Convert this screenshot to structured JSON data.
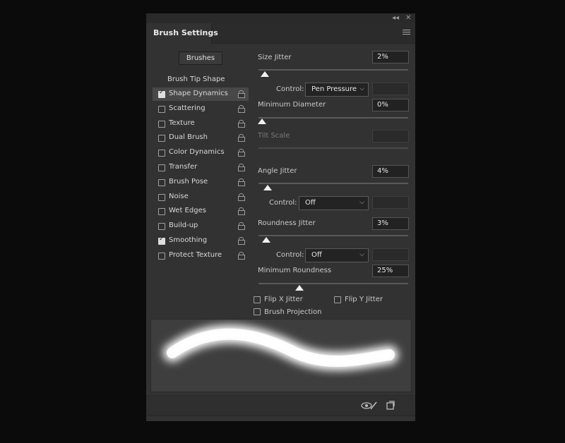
{
  "panel": {
    "title": "Brush Settings"
  },
  "left": {
    "brushes_button": "Brushes",
    "tip_shape_label": "Brush Tip Shape",
    "items": [
      {
        "label": "Shape Dynamics",
        "checked": true,
        "selected": true
      },
      {
        "label": "Scattering",
        "checked": false
      },
      {
        "label": "Texture",
        "checked": false
      },
      {
        "label": "Dual Brush",
        "checked": false
      },
      {
        "label": "Color Dynamics",
        "checked": false
      },
      {
        "label": "Transfer",
        "checked": false
      },
      {
        "label": "Brush Pose",
        "checked": false
      },
      {
        "label": "Noise",
        "checked": false
      },
      {
        "label": "Wet Edges",
        "checked": false
      },
      {
        "label": "Build-up",
        "checked": false
      },
      {
        "label": "Smoothing",
        "checked": true
      },
      {
        "label": "Protect Texture",
        "checked": false
      }
    ]
  },
  "settings": {
    "size_jitter": {
      "label": "Size Jitter",
      "value": "2%",
      "slider": 0.02
    },
    "size_control": {
      "label": "Control:",
      "value": "Pen Pressure"
    },
    "min_diameter": {
      "label": "Minimum Diameter",
      "value": "0%",
      "slider": 0.0
    },
    "tilt_scale": {
      "label": "Tilt Scale",
      "value": ""
    },
    "angle_jitter": {
      "label": "Angle Jitter",
      "value": "4%",
      "slider": 0.04
    },
    "angle_control": {
      "label": "Control:",
      "value": "Off"
    },
    "roundness_jitter": {
      "label": "Roundness Jitter",
      "value": "3%",
      "slider": 0.03
    },
    "roundness_control": {
      "label": "Control:",
      "value": "Off"
    },
    "min_roundness": {
      "label": "Minimum Roundness",
      "value": "25%",
      "slider": 0.25
    },
    "flip_x": {
      "label": "Flip X Jitter",
      "checked": false
    },
    "flip_y": {
      "label": "Flip Y Jitter",
      "checked": false
    },
    "projection": {
      "label": "Brush Projection",
      "checked": false
    }
  },
  "icons": {
    "collapse": "collapse-icon",
    "close": "close-icon",
    "menu": "panel-menu-icon",
    "toggle_preview": "toggle-live-tip-preview-icon",
    "create_new": "create-new-brush-icon"
  }
}
